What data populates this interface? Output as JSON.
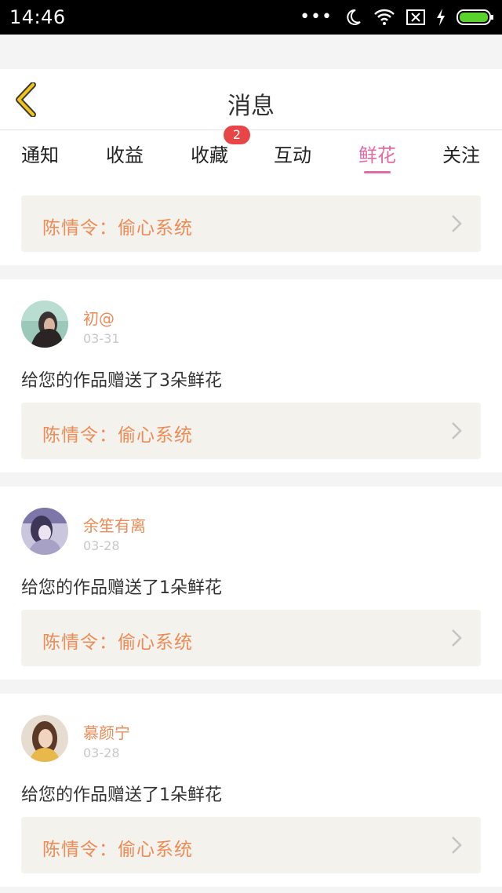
{
  "status_bar": {
    "time": "14:46",
    "icons": [
      "more-dots-icon",
      "moon-icon",
      "wifi-icon",
      "sim-x-icon",
      "charging-icon",
      "battery-icon"
    ],
    "dots": "•••"
  },
  "header": {
    "title": "消息",
    "back_icon": "chevron-left-icon",
    "accent_color": "#f0c419"
  },
  "tabs": {
    "items": [
      {
        "label": "通知"
      },
      {
        "label": "收益"
      },
      {
        "label": "收藏"
      },
      {
        "label": "互动"
      },
      {
        "label": "鲜花"
      },
      {
        "label": "关注"
      }
    ],
    "active": "鲜花",
    "badge": "2",
    "active_color": "#e36aa1"
  },
  "feed": {
    "top_ref": "陈情令：偷心系统",
    "items": [
      {
        "name": "初@",
        "date": "03-31",
        "message": "给您的作品赠送了3朵鲜花",
        "ref": "陈情令：偷心系统"
      },
      {
        "name": "余笙有离",
        "date": "03-28",
        "message": "给您的作品赠送了1朵鲜花",
        "ref": "陈情令：偷心系统"
      },
      {
        "name": "慕颜宁",
        "date": "03-28",
        "message": "给您的作品赠送了1朵鲜花",
        "ref": "陈情令：偷心系统"
      }
    ],
    "ref_color": "#ed8b57"
  }
}
